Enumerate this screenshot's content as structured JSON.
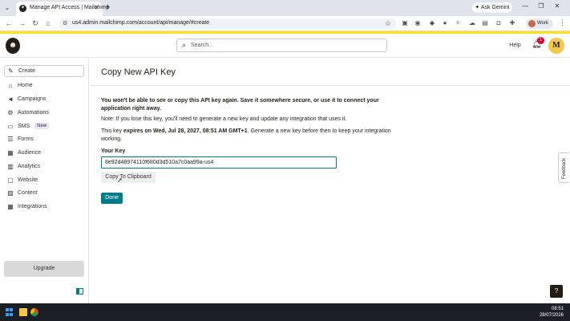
{
  "browser": {
    "tab_title": "Manage API Access | Mailchimp",
    "tab_favicon": "mailchimp-favicon",
    "url": "us4.admin.mailchimp.com/account/api/manage/#create",
    "ask_gemini_label": "Ask Gemini",
    "profile_label": "Work"
  },
  "header": {
    "search_placeholder": "Search...",
    "help_label": "Help",
    "notification_count": "1",
    "user_initial": "M",
    "accent_color": "#ffe01b"
  },
  "sidebar": {
    "create_label": "Create",
    "items": [
      {
        "label": "Home",
        "icon": "home-icon"
      },
      {
        "label": "Campaigns",
        "icon": "megaphone-icon"
      },
      {
        "label": "Automations",
        "icon": "automation-icon"
      },
      {
        "label": "SMS",
        "icon": "sms-icon",
        "badge": "New"
      },
      {
        "label": "Forms",
        "icon": "forms-icon"
      },
      {
        "label": "Audience",
        "icon": "audience-icon"
      },
      {
        "label": "Analytics",
        "icon": "analytics-icon"
      },
      {
        "label": "Website",
        "icon": "website-icon"
      },
      {
        "label": "Content",
        "icon": "content-icon"
      },
      {
        "label": "Integrations",
        "icon": "integrations-icon"
      }
    ],
    "upgrade_label": "Upgrade"
  },
  "main": {
    "title": "Copy New API Key",
    "warning": "You won't be able to see or copy this API key again. Save it somewhere secure, or use it to connect your application right away.",
    "note": "Note: If you lose this key, you'll need to generate a new key and update any integration that uses it.",
    "expires_prefix": "This key ",
    "expires_bold": "expires on Wed, Jul 28, 2027, 08:51 AM GMT+1",
    "expires_suffix": ". Generate a new key before then to keep your integration working.",
    "key_label": "Your Key",
    "key_value": "8e92d48974110f680d3d510a7c0aa99a-us4",
    "copy_button": "Copy To Clipboard",
    "done_button": "Done",
    "feedback_label": "Feedback",
    "help_button": "?",
    "button_color": "#007c89"
  },
  "taskbar": {
    "time": "08:51",
    "date": "28/07/2026"
  }
}
